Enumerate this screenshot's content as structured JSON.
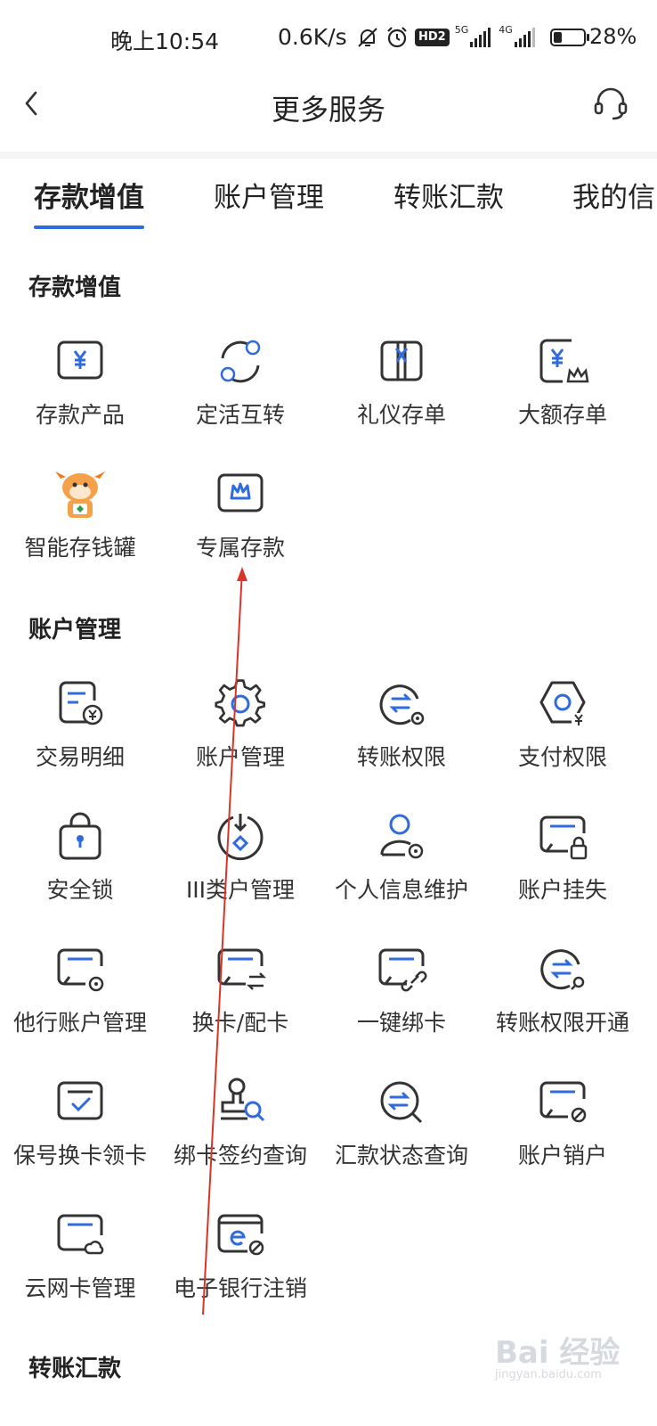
{
  "status_bar": {
    "time": "晚上10:54",
    "net_speed": "0.6K/s",
    "hd_badge": "HD2",
    "net_5g": "5G",
    "net_4g": "4G",
    "battery": "28%"
  },
  "header": {
    "title": "更多服务"
  },
  "tabs": [
    {
      "label": "存款增值",
      "active": true
    },
    {
      "label": "账户管理",
      "active": false
    },
    {
      "label": "转账汇款",
      "active": false
    },
    {
      "label": "我的信",
      "active": false
    }
  ],
  "sections": {
    "deposit": {
      "title": "存款增值",
      "items": [
        "存款产品",
        "定活互转",
        "礼仪存单",
        "大额存单",
        "智能存钱罐",
        "专属存款"
      ]
    },
    "account": {
      "title": "账户管理",
      "items": [
        "交易明细",
        "账户管理",
        "转账权限",
        "支付权限",
        "安全锁",
        "III类户管理",
        "个人信息维护",
        "账户挂失",
        "他行账户管理",
        "换卡/配卡",
        "一键绑卡",
        "转账权限开通",
        "保号换卡领卡",
        "绑卡签约查询",
        "汇款状态查询",
        "账户销户",
        "云网卡管理",
        "电子银行注销"
      ]
    },
    "transfer": {
      "title": "转账汇款"
    }
  },
  "watermark": {
    "text": "Bai 经验",
    "sub": "jingyan.baidu.com"
  },
  "colors": {
    "accent": "#2f6bdc",
    "icon_stroke": "#333333"
  }
}
